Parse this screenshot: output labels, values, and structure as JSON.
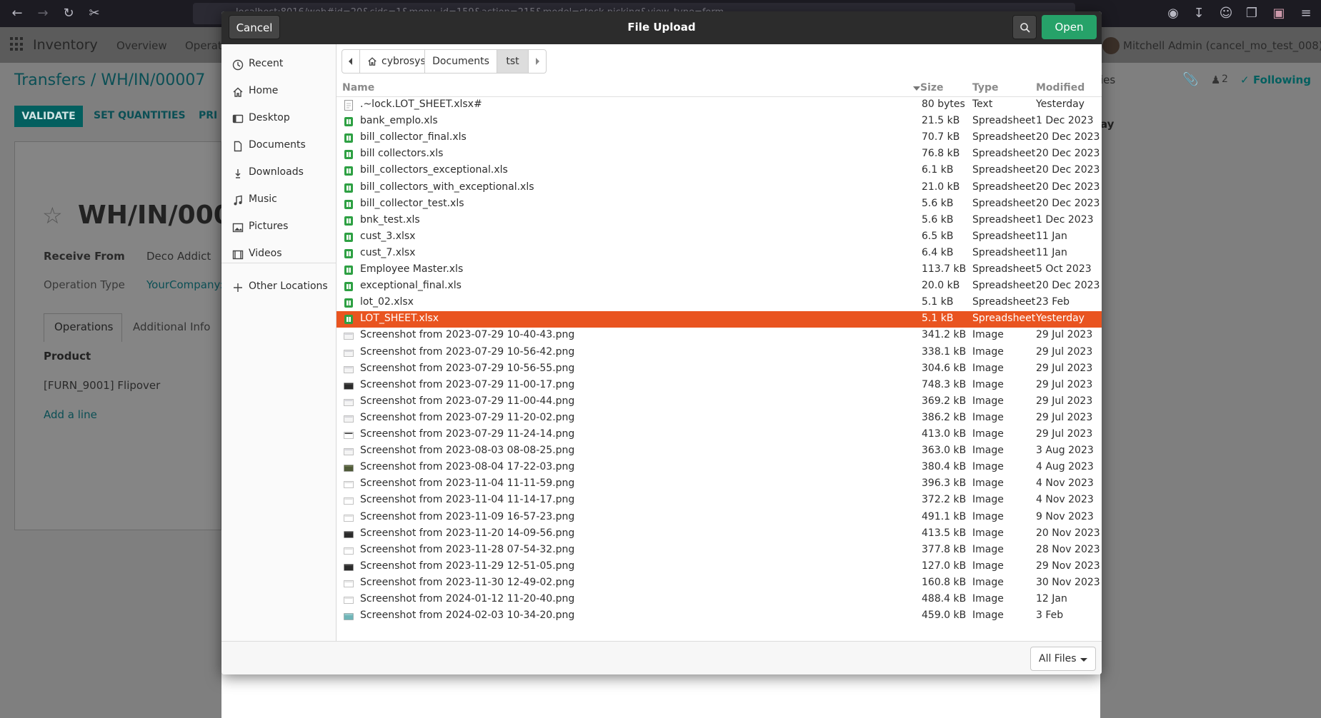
{
  "browser": {
    "url_fragment": "localhost:8016/web#id=20&cids=1&menu_id=159&action=215&model=stock.picking&view_type=form",
    "zoom": "120%"
  },
  "odoo": {
    "app_name": "Inventory",
    "menu": [
      "Overview",
      "Operati"
    ],
    "user": "Mitchell Admin (cancel_mo_test_008)",
    "breadcrumb": "Transfers / WH/IN/00007",
    "validate_label": "VALIDATE",
    "set_quantities_label": "SET QUANTITIES",
    "print_label": "PRI",
    "record_title": "WH/IN/0000",
    "receive_from_label": "Receive From",
    "receive_from_value": "Deco Addict",
    "operation_type_label": "Operation Type",
    "operation_type_value": "YourCompany:",
    "tab_operations": "Operations",
    "tab_additional": "Additional Info",
    "product_header": "Product",
    "product_row": "[FURN_9001] Flipover",
    "add_line": "Add a line",
    "following_label": "Following",
    "followers_count": "2",
    "quantities_partial": "ies",
    "today_partial": "ay"
  },
  "dialog": {
    "title": "File Upload",
    "cancel_label": "Cancel",
    "open_label": "Open",
    "sidebar": [
      {
        "label": "Recent",
        "icon": "clock-icon"
      },
      {
        "label": "Home",
        "icon": "home-icon"
      },
      {
        "label": "Desktop",
        "icon": "desktop-icon"
      },
      {
        "label": "Documents",
        "icon": "document-icon"
      },
      {
        "label": "Downloads",
        "icon": "download-icon"
      },
      {
        "label": "Music",
        "icon": "music-icon"
      },
      {
        "label": "Pictures",
        "icon": "pictures-icon"
      },
      {
        "label": "Videos",
        "icon": "video-icon"
      },
      {
        "label": "Other Locations",
        "icon": "plus-icon"
      }
    ],
    "path": [
      "cybrosys",
      "Documents",
      "tst"
    ],
    "columns": {
      "name": "Name",
      "size": "Size",
      "type": "Type",
      "modified": "Modified"
    },
    "files": [
      {
        "name": ".~lock.LOT_SHEET.xlsx#",
        "size": "80 bytes",
        "type": "Text",
        "modified": "Yesterday",
        "kind": "text"
      },
      {
        "name": "bank_emplo.xls",
        "size": "21.5 kB",
        "type": "Spreadsheet",
        "modified": "1 Dec 2023",
        "kind": "sheet"
      },
      {
        "name": "bill_collector_final.xls",
        "size": "70.7 kB",
        "type": "Spreadsheet",
        "modified": "20 Dec 2023",
        "kind": "sheet"
      },
      {
        "name": "bill collectors.xls",
        "size": "76.8 kB",
        "type": "Spreadsheet",
        "modified": "20 Dec 2023",
        "kind": "sheet"
      },
      {
        "name": "bill_collectors_exceptional.xls",
        "size": "6.1 kB",
        "type": "Spreadsheet",
        "modified": "20 Dec 2023",
        "kind": "sheet"
      },
      {
        "name": "bill_collectors_with_exceptional.xls",
        "size": "21.0 kB",
        "type": "Spreadsheet",
        "modified": "20 Dec 2023",
        "kind": "sheet"
      },
      {
        "name": "bill_collector_test.xls",
        "size": "5.6 kB",
        "type": "Spreadsheet",
        "modified": "20 Dec 2023",
        "kind": "sheet"
      },
      {
        "name": "bnk_test.xls",
        "size": "5.6 kB",
        "type": "Spreadsheet",
        "modified": "1 Dec 2023",
        "kind": "sheet"
      },
      {
        "name": "cust_3.xlsx",
        "size": "6.5 kB",
        "type": "Spreadsheet",
        "modified": "11 Jan",
        "kind": "sheet"
      },
      {
        "name": "cust_7.xlsx",
        "size": "6.4 kB",
        "type": "Spreadsheet",
        "modified": "11 Jan",
        "kind": "sheet"
      },
      {
        "name": "Employee Master.xls",
        "size": "113.7 kB",
        "type": "Spreadsheet",
        "modified": "5 Oct 2023",
        "kind": "sheet"
      },
      {
        "name": "exceptional_final.xls",
        "size": "20.0 kB",
        "type": "Spreadsheet",
        "modified": "20 Dec 2023",
        "kind": "sheet"
      },
      {
        "name": "lot_02.xlsx",
        "size": "5.1 kB",
        "type": "Spreadsheet",
        "modified": "23 Feb",
        "kind": "sheet"
      },
      {
        "name": "LOT_SHEET.xlsx",
        "size": "5.1 kB",
        "type": "Spreadsheet",
        "modified": "Yesterday",
        "kind": "sheet",
        "selected": true
      },
      {
        "name": "Screenshot from 2023-07-29 10-40-43.png",
        "size": "341.2 kB",
        "type": "Image",
        "modified": "29 Jul 2023",
        "kind": "image-light"
      },
      {
        "name": "Screenshot from 2023-07-29 10-56-42.png",
        "size": "338.1 kB",
        "type": "Image",
        "modified": "29 Jul 2023",
        "kind": "image-light"
      },
      {
        "name": "Screenshot from 2023-07-29 10-56-55.png",
        "size": "304.6 kB",
        "type": "Image",
        "modified": "29 Jul 2023",
        "kind": "image-light"
      },
      {
        "name": "Screenshot from 2023-07-29 11-00-17.png",
        "size": "748.3 kB",
        "type": "Image",
        "modified": "29 Jul 2023",
        "kind": "image-dark"
      },
      {
        "name": "Screenshot from 2023-07-29 11-00-44.png",
        "size": "369.2 kB",
        "type": "Image",
        "modified": "29 Jul 2023",
        "kind": "image-light"
      },
      {
        "name": "Screenshot from 2023-07-29 11-20-02.png",
        "size": "386.2 kB",
        "type": "Image",
        "modified": "29 Jul 2023",
        "kind": "image-light"
      },
      {
        "name": "Screenshot from 2023-07-29 11-24-14.png",
        "size": "413.0 kB",
        "type": "Image",
        "modified": "29 Jul 2023",
        "kind": "image-frame"
      },
      {
        "name": "Screenshot from 2023-08-03 08-08-25.png",
        "size": "363.0 kB",
        "type": "Image",
        "modified": "3 Aug 2023",
        "kind": "image-light"
      },
      {
        "name": "Screenshot from 2023-08-04 17-22-03.png",
        "size": "380.4 kB",
        "type": "Image",
        "modified": "4 Aug 2023",
        "kind": "image-olive"
      },
      {
        "name": "Screenshot from 2023-11-04 11-11-59.png",
        "size": "396.3 kB",
        "type": "Image",
        "modified": "4 Nov 2023",
        "kind": "image-white"
      },
      {
        "name": "Screenshot from 2023-11-04 11-14-17.png",
        "size": "372.2 kB",
        "type": "Image",
        "modified": "4 Nov 2023",
        "kind": "image-white"
      },
      {
        "name": "Screenshot from 2023-11-09 16-57-23.png",
        "size": "491.1 kB",
        "type": "Image",
        "modified": "9 Nov 2023",
        "kind": "image-white"
      },
      {
        "name": "Screenshot from 2023-11-20 14-09-56.png",
        "size": "413.5 kB",
        "type": "Image",
        "modified": "20 Nov 2023",
        "kind": "image-dark"
      },
      {
        "name": "Screenshot from 2023-11-28 07-54-32.png",
        "size": "377.8 kB",
        "type": "Image",
        "modified": "28 Nov 2023",
        "kind": "image-white"
      },
      {
        "name": "Screenshot from 2023-11-29 12-51-05.png",
        "size": "127.0 kB",
        "type": "Image",
        "modified": "29 Nov 2023",
        "kind": "image-dark"
      },
      {
        "name": "Screenshot from 2023-11-30 12-49-02.png",
        "size": "160.8 kB",
        "type": "Image",
        "modified": "30 Nov 2023",
        "kind": "image-white"
      },
      {
        "name": "Screenshot from 2024-01-12 11-20-40.png",
        "size": "488.4 kB",
        "type": "Image",
        "modified": "12 Jan",
        "kind": "image-white"
      },
      {
        "name": "Screenshot from 2024-02-03 10-34-20.png",
        "size": "459.0 kB",
        "type": "Image",
        "modified": "3 Feb",
        "kind": "image-teal"
      }
    ],
    "filter_label": "All Files"
  }
}
